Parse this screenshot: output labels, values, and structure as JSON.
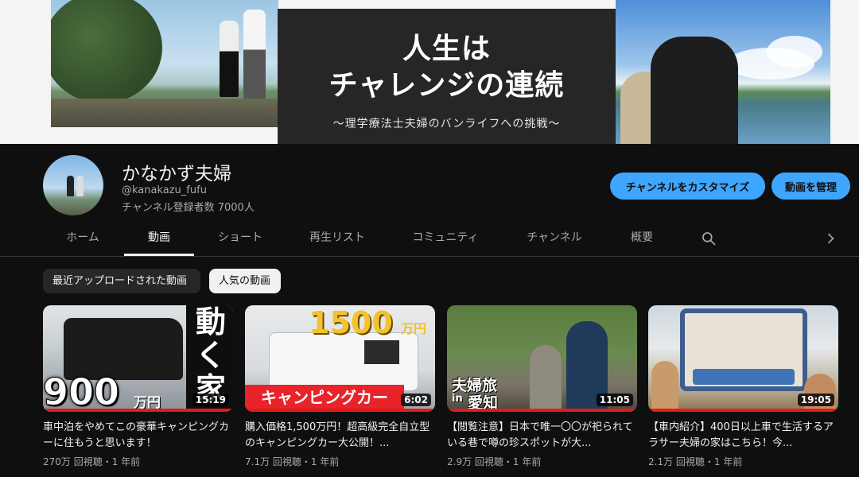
{
  "banner": {
    "title_line1": "人生は",
    "title_line2": "チャレンジの連続",
    "subtitle": "〜理学療法士夫婦のバンライフへの挑戦〜"
  },
  "channel": {
    "name": "かなかず夫婦",
    "handle": "@kanakazu_fufu",
    "subscribers": "チャンネル登録者数 7000人",
    "customize_label": "チャンネルをカスタマイズ",
    "manage_label": "動画を管理"
  },
  "tabs": [
    {
      "label": "ホーム",
      "active": false
    },
    {
      "label": "動画",
      "active": true
    },
    {
      "label": "ショート",
      "active": false
    },
    {
      "label": "再生リスト",
      "active": false
    },
    {
      "label": "コミュニティ",
      "active": false
    },
    {
      "label": "チャンネル",
      "active": false
    },
    {
      "label": "概要",
      "active": false
    }
  ],
  "icons": {
    "search": "search-icon",
    "next": "chevron-right-icon"
  },
  "filters": {
    "recent": "最近アップロードされた動画",
    "popular": "人気の動画",
    "selected": "popular"
  },
  "videos": [
    {
      "title": "車中泊をやめてこの豪華キャンピングカーに住もうと思います！",
      "meta": "270万 回視聴・1 年前",
      "duration": "15:19",
      "overlay_main": "900",
      "overlay_unit": "万円",
      "overlay_side": "動く家"
    },
    {
      "title": "購入価格1,500万円！超高級完全自立型のキャンピングカー大公開！...",
      "meta": "7.1万 回視聴・1 年前",
      "duration": "6:02",
      "overlay_main": "1500",
      "overlay_unit": "万円",
      "overlay_side": "キャンピングカー"
    },
    {
      "title": "【閲覧注意】日本で唯一〇〇が祀られている巷で噂の珍スポットが大...",
      "meta": "2.9万 回視聴・1 年前",
      "duration": "11:05",
      "overlay_main": "夫婦旅",
      "overlay_unit": "in",
      "overlay_side": "愛知"
    },
    {
      "title": "【車内紹介】400日以上車で生活するアラサー夫婦の家はこちら！今...",
      "meta": "2.1万 回視聴・1 年前",
      "duration": "19:05",
      "overlay_main": "",
      "overlay_unit": "",
      "overlay_side": ""
    }
  ],
  "colors": {
    "accent": "#3ea6ff",
    "background": "#0f0f0f",
    "progress": "#e21b1b"
  }
}
